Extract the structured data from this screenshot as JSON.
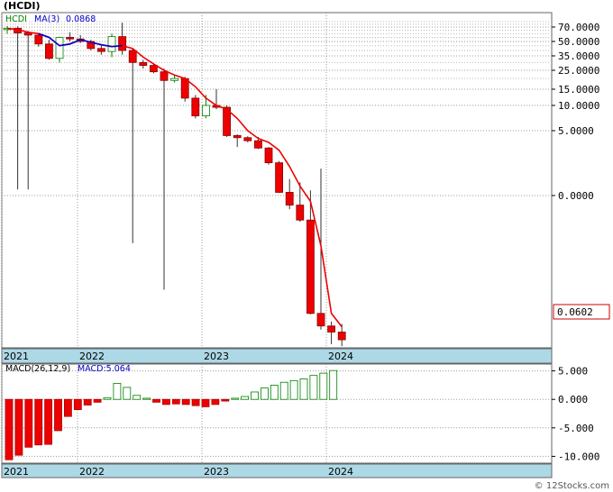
{
  "title": "(HCDI)",
  "footer": "© 12Stocks.com",
  "chart_data": [
    {
      "type": "candlestick",
      "id": "price",
      "legend": [
        {
          "text": "HCDI",
          "color": "#008000"
        },
        {
          "text": "MA(3)",
          "color": "#0000cc"
        },
        {
          "text": "0.0868",
          "color": "#0000cc"
        }
      ],
      "scale": "log-like",
      "y_ticks": [
        "70.0000",
        "50.0000",
        "35.0000",
        "25.0000",
        "15.0000",
        "10.0000",
        "5.0000",
        "0.0000"
      ],
      "last_price_label": "0.0602",
      "x_labels": [
        "2021",
        "2022",
        "2023",
        "2024"
      ],
      "candles": [
        {
          "o": 66,
          "h": 72,
          "l": 60,
          "c": 68
        },
        {
          "o": 68,
          "h": 71,
          "l": 0.62,
          "c": 61
        },
        {
          "o": 61,
          "h": 64,
          "l": 0.62,
          "c": 58
        },
        {
          "o": 58,
          "h": 60,
          "l": 44,
          "c": 47
        },
        {
          "o": 47,
          "h": 52,
          "l": 32,
          "c": 33
        },
        {
          "o": 33,
          "h": 56,
          "l": 30,
          "c": 55
        },
        {
          "o": 55,
          "h": 62,
          "l": 50,
          "c": 53
        },
        {
          "o": 53,
          "h": 58,
          "l": 48,
          "c": 50
        },
        {
          "o": 50,
          "h": 52,
          "l": 40,
          "c": 42
        },
        {
          "o": 42,
          "h": 45,
          "l": 36,
          "c": 39
        },
        {
          "o": 39,
          "h": 60,
          "l": 34,
          "c": 56
        },
        {
          "o": 56,
          "h": 78,
          "l": 36,
          "c": 40
        },
        {
          "o": 40,
          "h": 42,
          "l": 0.21,
          "c": 30
        },
        {
          "o": 30,
          "h": 32,
          "l": 26,
          "c": 28
        },
        {
          "o": 28,
          "h": 29,
          "l": 23,
          "c": 24
        },
        {
          "o": 24,
          "h": 26,
          "l": 0.09,
          "c": 19
        },
        {
          "o": 19,
          "h": 22,
          "l": 18,
          "c": 20
        },
        {
          "o": 20,
          "h": 21,
          "l": 11,
          "c": 12
        },
        {
          "o": 12,
          "h": 13,
          "l": 7,
          "c": 7.5
        },
        {
          "o": 7.5,
          "h": 13,
          "l": 7,
          "c": 10
        },
        {
          "o": 10,
          "h": 15,
          "l": 9,
          "c": 9.5
        },
        {
          "o": 9.5,
          "h": 10,
          "l": 4,
          "c": 4.2
        },
        {
          "o": 4.2,
          "h": 4.4,
          "l": 2.8,
          "c": 3.9
        },
        {
          "o": 3.9,
          "h": 4.1,
          "l": 3.3,
          "c": 3.5
        },
        {
          "o": 3.5,
          "h": 4,
          "l": 2.6,
          "c": 2.7
        },
        {
          "o": 2.7,
          "h": 2.8,
          "l": 1.5,
          "c": 1.6
        },
        {
          "o": 1.6,
          "h": 1.7,
          "l": 0.55,
          "c": 0.56
        },
        {
          "o": 0.56,
          "h": 0.9,
          "l": 0.39,
          "c": 0.42
        },
        {
          "o": 0.42,
          "h": 0.8,
          "l": 0.31,
          "c": 0.32
        },
        {
          "o": 0.32,
          "h": 0.6,
          "l": 0.045,
          "c": 0.05
        },
        {
          "o": 0.05,
          "h": 1.3,
          "l": 0.008,
          "c": 0.012
        },
        {
          "o": 0.012,
          "h": 0.02,
          "l": 0.0015,
          "c": 0.006
        },
        {
          "o": 0.006,
          "h": 0.015,
          "l": 0.0012,
          "c": 0.0025
        }
      ],
      "ma": [
        68,
        66,
        62,
        60,
        55,
        45,
        47,
        52,
        49,
        46,
        44,
        45,
        42,
        34,
        29,
        25,
        22,
        20,
        16,
        12,
        10,
        9,
        7,
        5,
        3.8,
        3.3,
        2.5,
        1.4,
        0.7,
        0.45,
        0.2,
        0.05,
        0.011
      ]
    },
    {
      "type": "bar",
      "id": "macd",
      "legend": [
        {
          "text": "MACD(26,12,9)",
          "color": "#000000"
        },
        {
          "text": "MACD:5.064",
          "color": "#0000cc"
        }
      ],
      "y_ticks": [
        {
          "label": "5.000",
          "value": 5
        },
        {
          "label": "0.000",
          "value": 0
        },
        {
          "label": "-5.000",
          "value": -5
        },
        {
          "label": "-10.000",
          "value": -10
        }
      ],
      "ylim": [
        -11.2,
        6.2
      ],
      "x_labels": [
        "2021",
        "2022",
        "2023",
        "2024"
      ],
      "values": [
        -10.6,
        -9.8,
        -8.4,
        -8.0,
        -7.9,
        -5.5,
        -3.0,
        -1.8,
        -1.0,
        -0.5,
        0.3,
        2.8,
        2.1,
        0.7,
        0.2,
        -0.5,
        -0.9,
        -0.8,
        -0.9,
        -1.1,
        -1.3,
        -0.9,
        -0.3,
        0.2,
        0.5,
        1.3,
        2.0,
        2.5,
        3.0,
        3.3,
        3.6,
        4.2,
        4.6,
        5.064
      ]
    }
  ]
}
